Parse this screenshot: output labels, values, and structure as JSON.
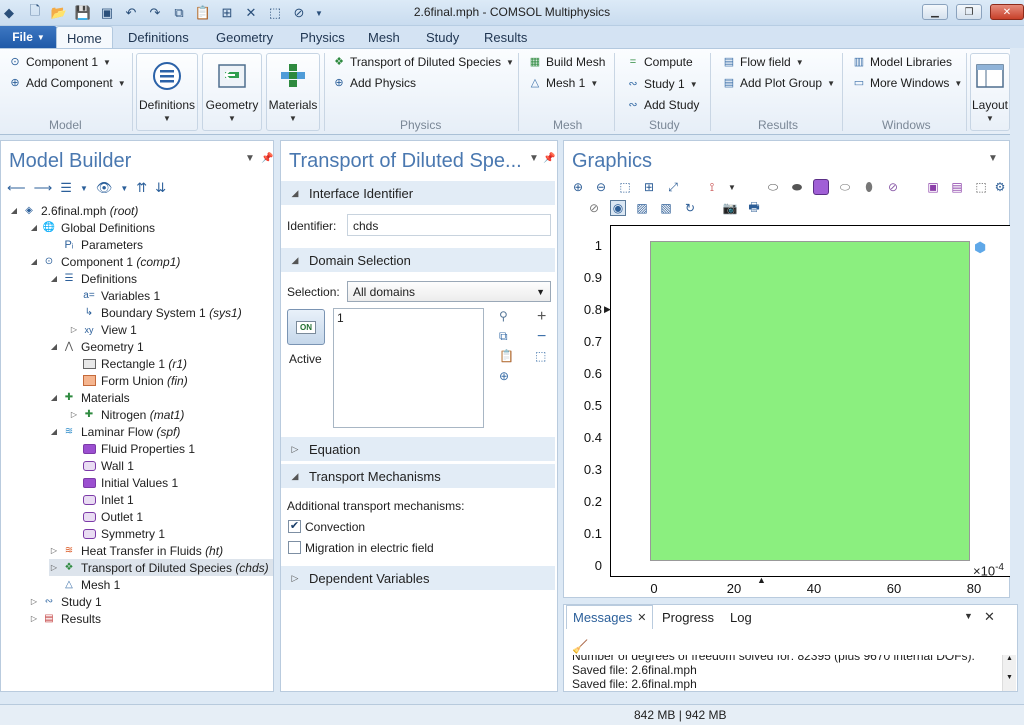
{
  "window": {
    "title": "2.6final.mph - COMSOL Multiphysics"
  },
  "ribbon_tabs": {
    "file": "File",
    "home": "Home",
    "definitions": "Definitions",
    "geometry": "Geometry",
    "physics": "Physics",
    "mesh": "Mesh",
    "study": "Study",
    "results": "Results"
  },
  "ribbon": {
    "model": {
      "component": "Component 1",
      "add_component": "Add Component",
      "group": "Model"
    },
    "big": {
      "definitions": "Definitions",
      "geometry": "Geometry",
      "materials": "Materials"
    },
    "physics": {
      "transport": "Transport of Diluted Species",
      "add_physics": "Add Physics",
      "group": "Physics"
    },
    "mesh": {
      "build": "Build Mesh",
      "mesh1": "Mesh 1",
      "group": "Mesh"
    },
    "study": {
      "compute": "Compute",
      "study1": "Study 1",
      "add_study": "Add Study",
      "group": "Study"
    },
    "results": {
      "flow_field": "Flow field",
      "add_plot_group": "Add Plot Group",
      "group": "Results"
    },
    "windows": {
      "model_libraries": "Model Libraries",
      "more_windows": "More Windows",
      "group": "Windows"
    },
    "layout": "Layout"
  },
  "model_builder": {
    "title": "Model Builder",
    "tree": [
      {
        "label": "2.6final.mph",
        "tag": "(root)",
        "icon": "mph-icon"
      },
      {
        "label": "Global Definitions",
        "tag": "",
        "icon": "globe-icon"
      },
      {
        "label": "Parameters",
        "tag": "",
        "icon": "pi-icon"
      },
      {
        "label": "Component 1",
        "tag": "(comp1)",
        "icon": "component-icon"
      },
      {
        "label": "Definitions",
        "tag": "",
        "icon": "definitions-icon"
      },
      {
        "label": "Variables 1",
        "tag": "",
        "icon": "variables-icon"
      },
      {
        "label": "Boundary System 1",
        "tag": "(sys1)",
        "icon": "coordinate-system-icon"
      },
      {
        "label": "View 1",
        "tag": "",
        "icon": "view-icon"
      },
      {
        "label": "Geometry 1",
        "tag": "",
        "icon": "geometry-icon"
      },
      {
        "label": "Rectangle 1",
        "tag": "(r1)",
        "icon": "rectangle-icon"
      },
      {
        "label": "Form Union",
        "tag": "(fin)",
        "icon": "form-union-icon"
      },
      {
        "label": "Materials",
        "tag": "",
        "icon": "materials-icon"
      },
      {
        "label": "Nitrogen",
        "tag": "(mat1)",
        "icon": "material-icon"
      },
      {
        "label": "Laminar Flow",
        "tag": "(spf)",
        "icon": "laminar-flow-icon"
      },
      {
        "label": "Fluid Properties 1",
        "tag": "",
        "icon": "domain-feature-icon"
      },
      {
        "label": "Wall 1",
        "tag": "",
        "icon": "boundary-feature-icon"
      },
      {
        "label": "Initial Values 1",
        "tag": "",
        "icon": "domain-feature-icon"
      },
      {
        "label": "Inlet 1",
        "tag": "",
        "icon": "boundary-feature-icon"
      },
      {
        "label": "Outlet 1",
        "tag": "",
        "icon": "boundary-feature-icon"
      },
      {
        "label": "Symmetry 1",
        "tag": "",
        "icon": "boundary-feature-icon"
      },
      {
        "label": "Heat Transfer in Fluids",
        "tag": "(ht)",
        "icon": "heat-transfer-icon"
      },
      {
        "label": "Transport of Diluted Species",
        "tag": "(chds)",
        "icon": "transport-icon"
      },
      {
        "label": "Mesh 1",
        "tag": "",
        "icon": "mesh-icon"
      },
      {
        "label": "Study 1",
        "tag": "",
        "icon": "study-icon"
      },
      {
        "label": "Results",
        "tag": "",
        "icon": "results-icon"
      }
    ]
  },
  "settings": {
    "title": "Transport of Diluted Spe...",
    "interface_identifier": "Interface Identifier",
    "identifier_label": "Identifier:",
    "identifier_value": "chds",
    "domain_selection": "Domain Selection",
    "selection_label": "Selection:",
    "selection_value": "All domains",
    "active_label": "Active",
    "on_label": "ON",
    "selection_item": "1",
    "equation": "Equation",
    "transport_mechanisms": "Transport Mechanisms",
    "additional": "Additional transport mechanisms:",
    "convection": "Convection",
    "convection_checked": true,
    "migration": "Migration in electric field",
    "migration_checked": false,
    "dependent_variables": "Dependent Variables"
  },
  "graphics": {
    "title": "Graphics",
    "y_ticks": [
      "1",
      "0.9",
      "0.8",
      "0.7",
      "0.6",
      "0.5",
      "0.4",
      "0.3",
      "0.2",
      "0.1",
      "0"
    ],
    "x_ticks": [
      "0",
      "20",
      "40",
      "60",
      "80"
    ],
    "x_scale_label": "×10",
    "x_scale_exp": "-4",
    "domain_color": "#8bef7f"
  },
  "messages": {
    "tabs": {
      "messages": "Messages",
      "progress": "Progress",
      "log": "Log"
    },
    "lines": [
      "Number of degrees of freedom solved for: 82395 (plus 9670 internal DOFs).",
      "Saved file: 2.6final.mph",
      "Saved file: 2.6final.mph"
    ]
  },
  "status": {
    "memory": "842 MB | 942 MB"
  }
}
